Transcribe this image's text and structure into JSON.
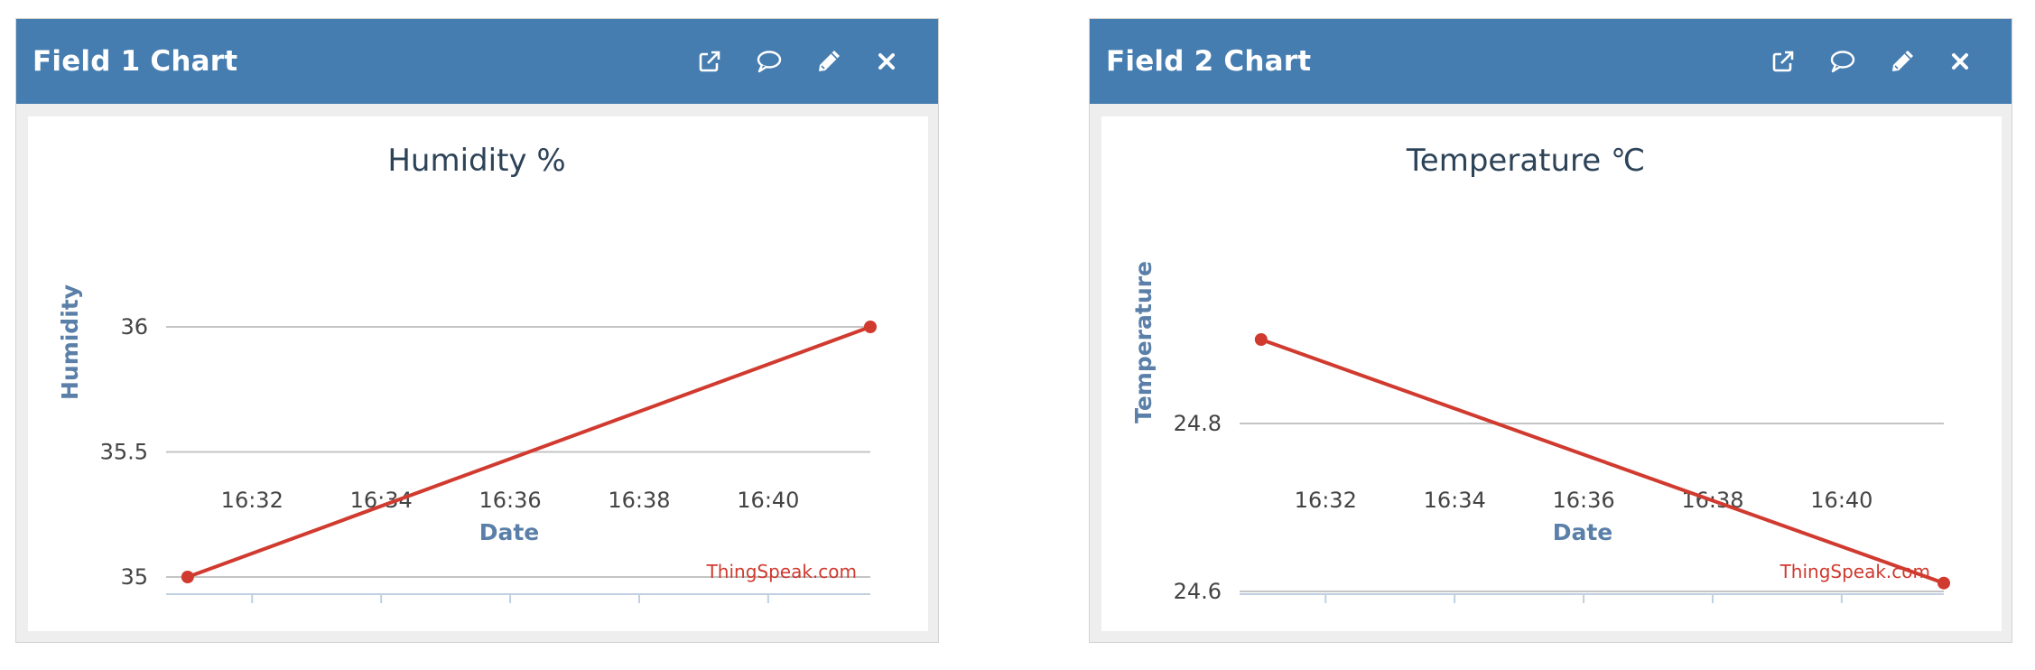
{
  "widgets": [
    {
      "title": "Field 1 Chart",
      "icons": {
        "open": "external-link-icon",
        "comment": "comment-icon",
        "edit": "pencil-icon",
        "close": "close-icon"
      },
      "chart_data": {
        "type": "line",
        "title": "Humidity %",
        "xlabel": "Date",
        "ylabel": "Humidity",
        "x_ticks": [
          "16:32",
          "16:34",
          "16:36",
          "16:38",
          "16:40"
        ],
        "y_ticks": [
          "35",
          "35.5",
          "36"
        ],
        "credits": "ThingSpeak.com",
        "series": [
          {
            "x": [
              "16:31",
              "16:41:35"
            ],
            "y": [
              35,
              36
            ],
            "color": "#d03a2f"
          }
        ]
      }
    },
    {
      "title": "Field 2 Chart",
      "icons": {
        "open": "external-link-icon",
        "comment": "comment-icon",
        "edit": "pencil-icon",
        "close": "close-icon"
      },
      "chart_data": {
        "type": "line",
        "title": "Temperature ℃",
        "xlabel": "Date",
        "ylabel": "Temperature",
        "x_ticks": [
          "16:32",
          "16:34",
          "16:36",
          "16:38",
          "16:40"
        ],
        "y_ticks": [
          "24.6",
          "24.8"
        ],
        "credits": "ThingSpeak.com",
        "series": [
          {
            "x": [
              "16:31",
              "16:41:35"
            ],
            "y": [
              24.9,
              24.61
            ],
            "color": "#d03a2f"
          }
        ]
      }
    }
  ],
  "colors": {
    "header": "#467db0",
    "title_text": "#2d4358",
    "axis_title": "#5a7fa8",
    "series": "#d03a2f",
    "credits": "#d03a2f"
  }
}
